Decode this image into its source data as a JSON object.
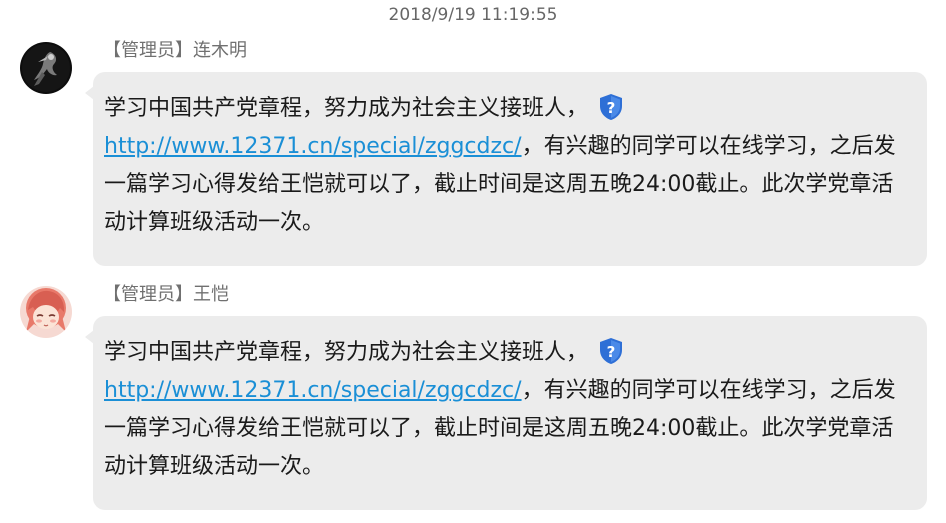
{
  "timestamp": "2018/9/19 11:19:55",
  "colors": {
    "bubble": "#ececec",
    "link": "#1a8fd6",
    "sender": "#707070",
    "security_badge": "#2e6fd6"
  },
  "messages": [
    {
      "sender": "【管理员】连木明",
      "avatar_icon": "dark-figure-avatar",
      "text_before_link": "学习中国共产党章程，努力成为社会主义接班人，",
      "badge_icon": "security-shield-icon",
      "link": "http://www.12371.cn/special/zggcdzc/",
      "text_after_link": "，有兴趣的同学可以在线学习，之后发一篇学习心得发给王恺就可以了，截止时间是这周五晚24:00截止。此次学党章活动计算班级活动一次。"
    },
    {
      "sender": "【管理员】王恺",
      "avatar_icon": "anime-girl-avatar",
      "text_before_link": "学习中国共产党章程，努力成为社会主义接班人，",
      "badge_icon": "security-shield-icon",
      "link": "http://www.12371.cn/special/zggcdzc/",
      "text_after_link": "，有兴趣的同学可以在线学习，之后发一篇学习心得发给王恺就可以了，截止时间是这周五晚24:00截止。此次学党章活动计算班级活动一次。"
    }
  ]
}
